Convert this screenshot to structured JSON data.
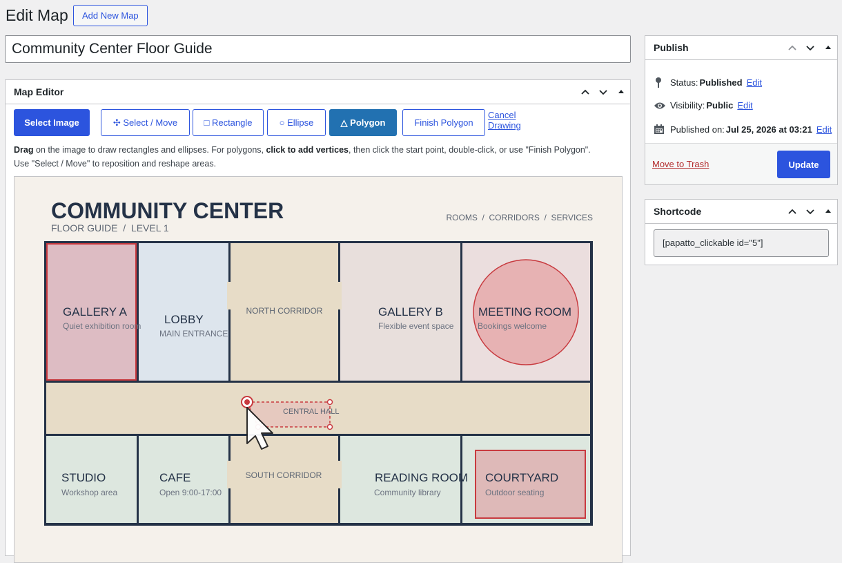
{
  "header": {
    "title": "Edit Map",
    "add_new_label": "Add New Map"
  },
  "post_title": "Community Center Floor Guide",
  "map_editor": {
    "title": "Map Editor",
    "toolbar": {
      "select_image": "Select Image",
      "select_move": "✣ Select / Move",
      "rectangle": "□ Rectangle",
      "ellipse": "○ Ellipse",
      "polygon": "△ Polygon",
      "finish_polygon": "Finish Polygon",
      "cancel_drawing": "Cancel Drawing",
      "active_tool": "polygon"
    },
    "help": {
      "drag_bold": "Drag",
      "part1": " on the image to draw rectangles and ellipses. For polygons, ",
      "click_bold": "click to add vertices",
      "part2": ", then click the start point, double-click, or use \"Finish Polygon\".",
      "line2": "Use \"Select / Move\" to reposition and reshape areas."
    }
  },
  "floor_plan": {
    "heading": "COMMUNITY CENTER",
    "subheading": "FLOOR GUIDE  /  LEVEL 1",
    "nav": "ROOMS  /  CORRIDORS  /  SERVICES",
    "rooms": {
      "gallery_a": {
        "name": "GALLERY A",
        "sub": "Quiet exhibition room"
      },
      "lobby": {
        "name": "LOBBY",
        "sub": "MAIN ENTRANCE"
      },
      "north_corridor": {
        "name": "NORTH CORRIDOR"
      },
      "gallery_b": {
        "name": "GALLERY B",
        "sub": "Flexible event space"
      },
      "meeting_room": {
        "name": "MEETING ROOM",
        "sub": "Bookings welcome"
      },
      "central_hall": {
        "name": "CENTRAL HALL"
      },
      "studio": {
        "name": "STUDIO",
        "sub": "Workshop area"
      },
      "cafe": {
        "name": "CAFE",
        "sub": "Open 9:00-17:00"
      },
      "south_corridor": {
        "name": "SOUTH CORRIDOR"
      },
      "reading_room": {
        "name": "READING ROOM",
        "sub": "Community library"
      },
      "courtyard": {
        "name": "COURTYARD",
        "sub": "Outdoor seating"
      }
    }
  },
  "publish": {
    "title": "Publish",
    "status_label": "Status:",
    "status_value": "Published",
    "visibility_label": "Visibility:",
    "visibility_value": "Public",
    "published_label": "Published on:",
    "published_value": "Jul 25, 2026 at 03:21",
    "edit_label": "Edit",
    "trash_label": "Move to Trash",
    "update_label": "Update"
  },
  "shortcode": {
    "title": "Shortcode",
    "value": "[papatto_clickable id=\"5\"]"
  },
  "colors": {
    "accent": "#2c54de",
    "active_tool": "#2271b1",
    "highlight_area": "#c83a3f",
    "wall": "#243247"
  }
}
